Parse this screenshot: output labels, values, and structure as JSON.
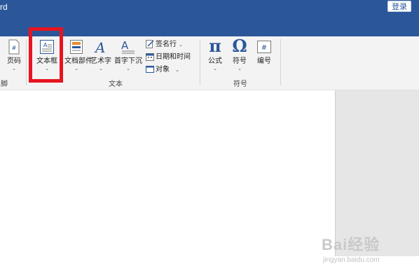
{
  "title_bar": {
    "app_title_fragment": "rd",
    "login_label": "登录",
    "accent_color": "#2b579a"
  },
  "ribbon": {
    "groups": {
      "header_footer_label_fragment": "脚",
      "text_label": "文本",
      "symbols_label": "符号"
    },
    "buttons": {
      "page_number": "页码",
      "text_box": "文本框",
      "quick_parts": "文档部件",
      "wordart": "艺术字",
      "drop_cap": "首字下沉",
      "signature_line": "签名行",
      "date_time": "日期和时间",
      "object": "对象",
      "equation": "公式",
      "symbol": "符号",
      "number": "编号"
    },
    "icons": {
      "equation_glyph": "π",
      "symbol_glyph": "Ω",
      "page_number_glyph": "#",
      "number_glyph": "#"
    }
  },
  "highlight": {
    "color": "#e8141e",
    "target": "文本框"
  },
  "watermark": {
    "logo": "Bai经验",
    "url": "jingyan.baidu.com"
  }
}
